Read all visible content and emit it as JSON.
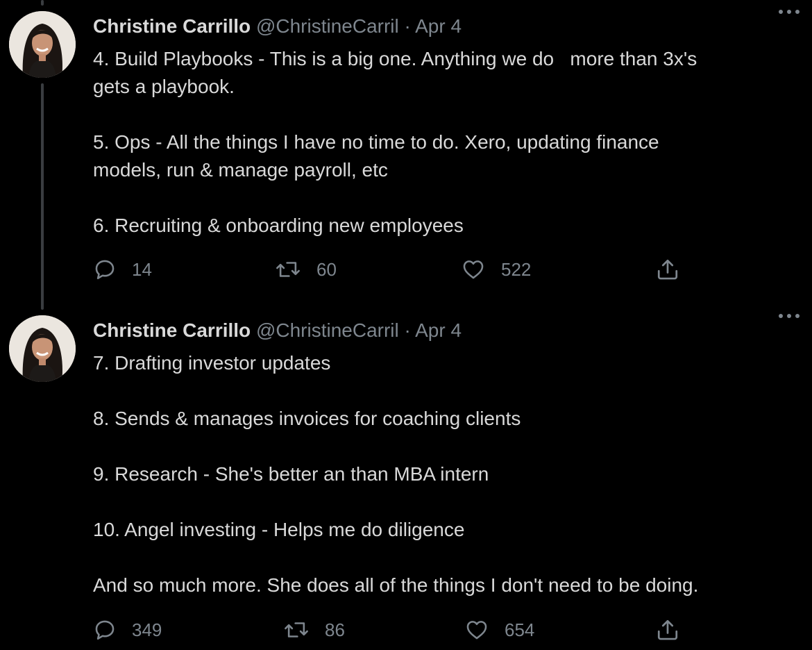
{
  "tweets": [
    {
      "author_name": "Christine Carrillo",
      "handle": "@ChristineCarril",
      "separator": "·",
      "date": "Apr 4",
      "text": "4. Build Playbooks - This is a big one. Anything we do   more than 3x's\ngets a playbook.\n\n5. Ops - All the things I have no time to do. Xero, updating finance\nmodels, run & manage payroll, etc\n\n6. Recruiting & onboarding new employees",
      "replies": "14",
      "retweets": "60",
      "likes": "522"
    },
    {
      "author_name": "Christine Carrillo",
      "handle": "@ChristineCarril",
      "separator": "·",
      "date": "Apr 4",
      "text": "7. Drafting investor updates\n\n8. Sends & manages invoices for coaching clients\n\n9. Research - She's better an than MBA intern\n\n10. Angel investing - Helps me do diligence\n\nAnd so much more. She does all of the things I don't need to be doing.",
      "replies": "349",
      "retweets": "86",
      "likes": "654"
    }
  ],
  "icons": {
    "more": "more-horizontal-icon",
    "reply": "reply-icon",
    "retweet": "retweet-icon",
    "like": "heart-icon",
    "share": "share-icon"
  },
  "colors": {
    "background": "#000000",
    "primary_text": "#d9d9d9",
    "secondary_text": "#7e868e",
    "thread_line": "#3a3d40"
  }
}
